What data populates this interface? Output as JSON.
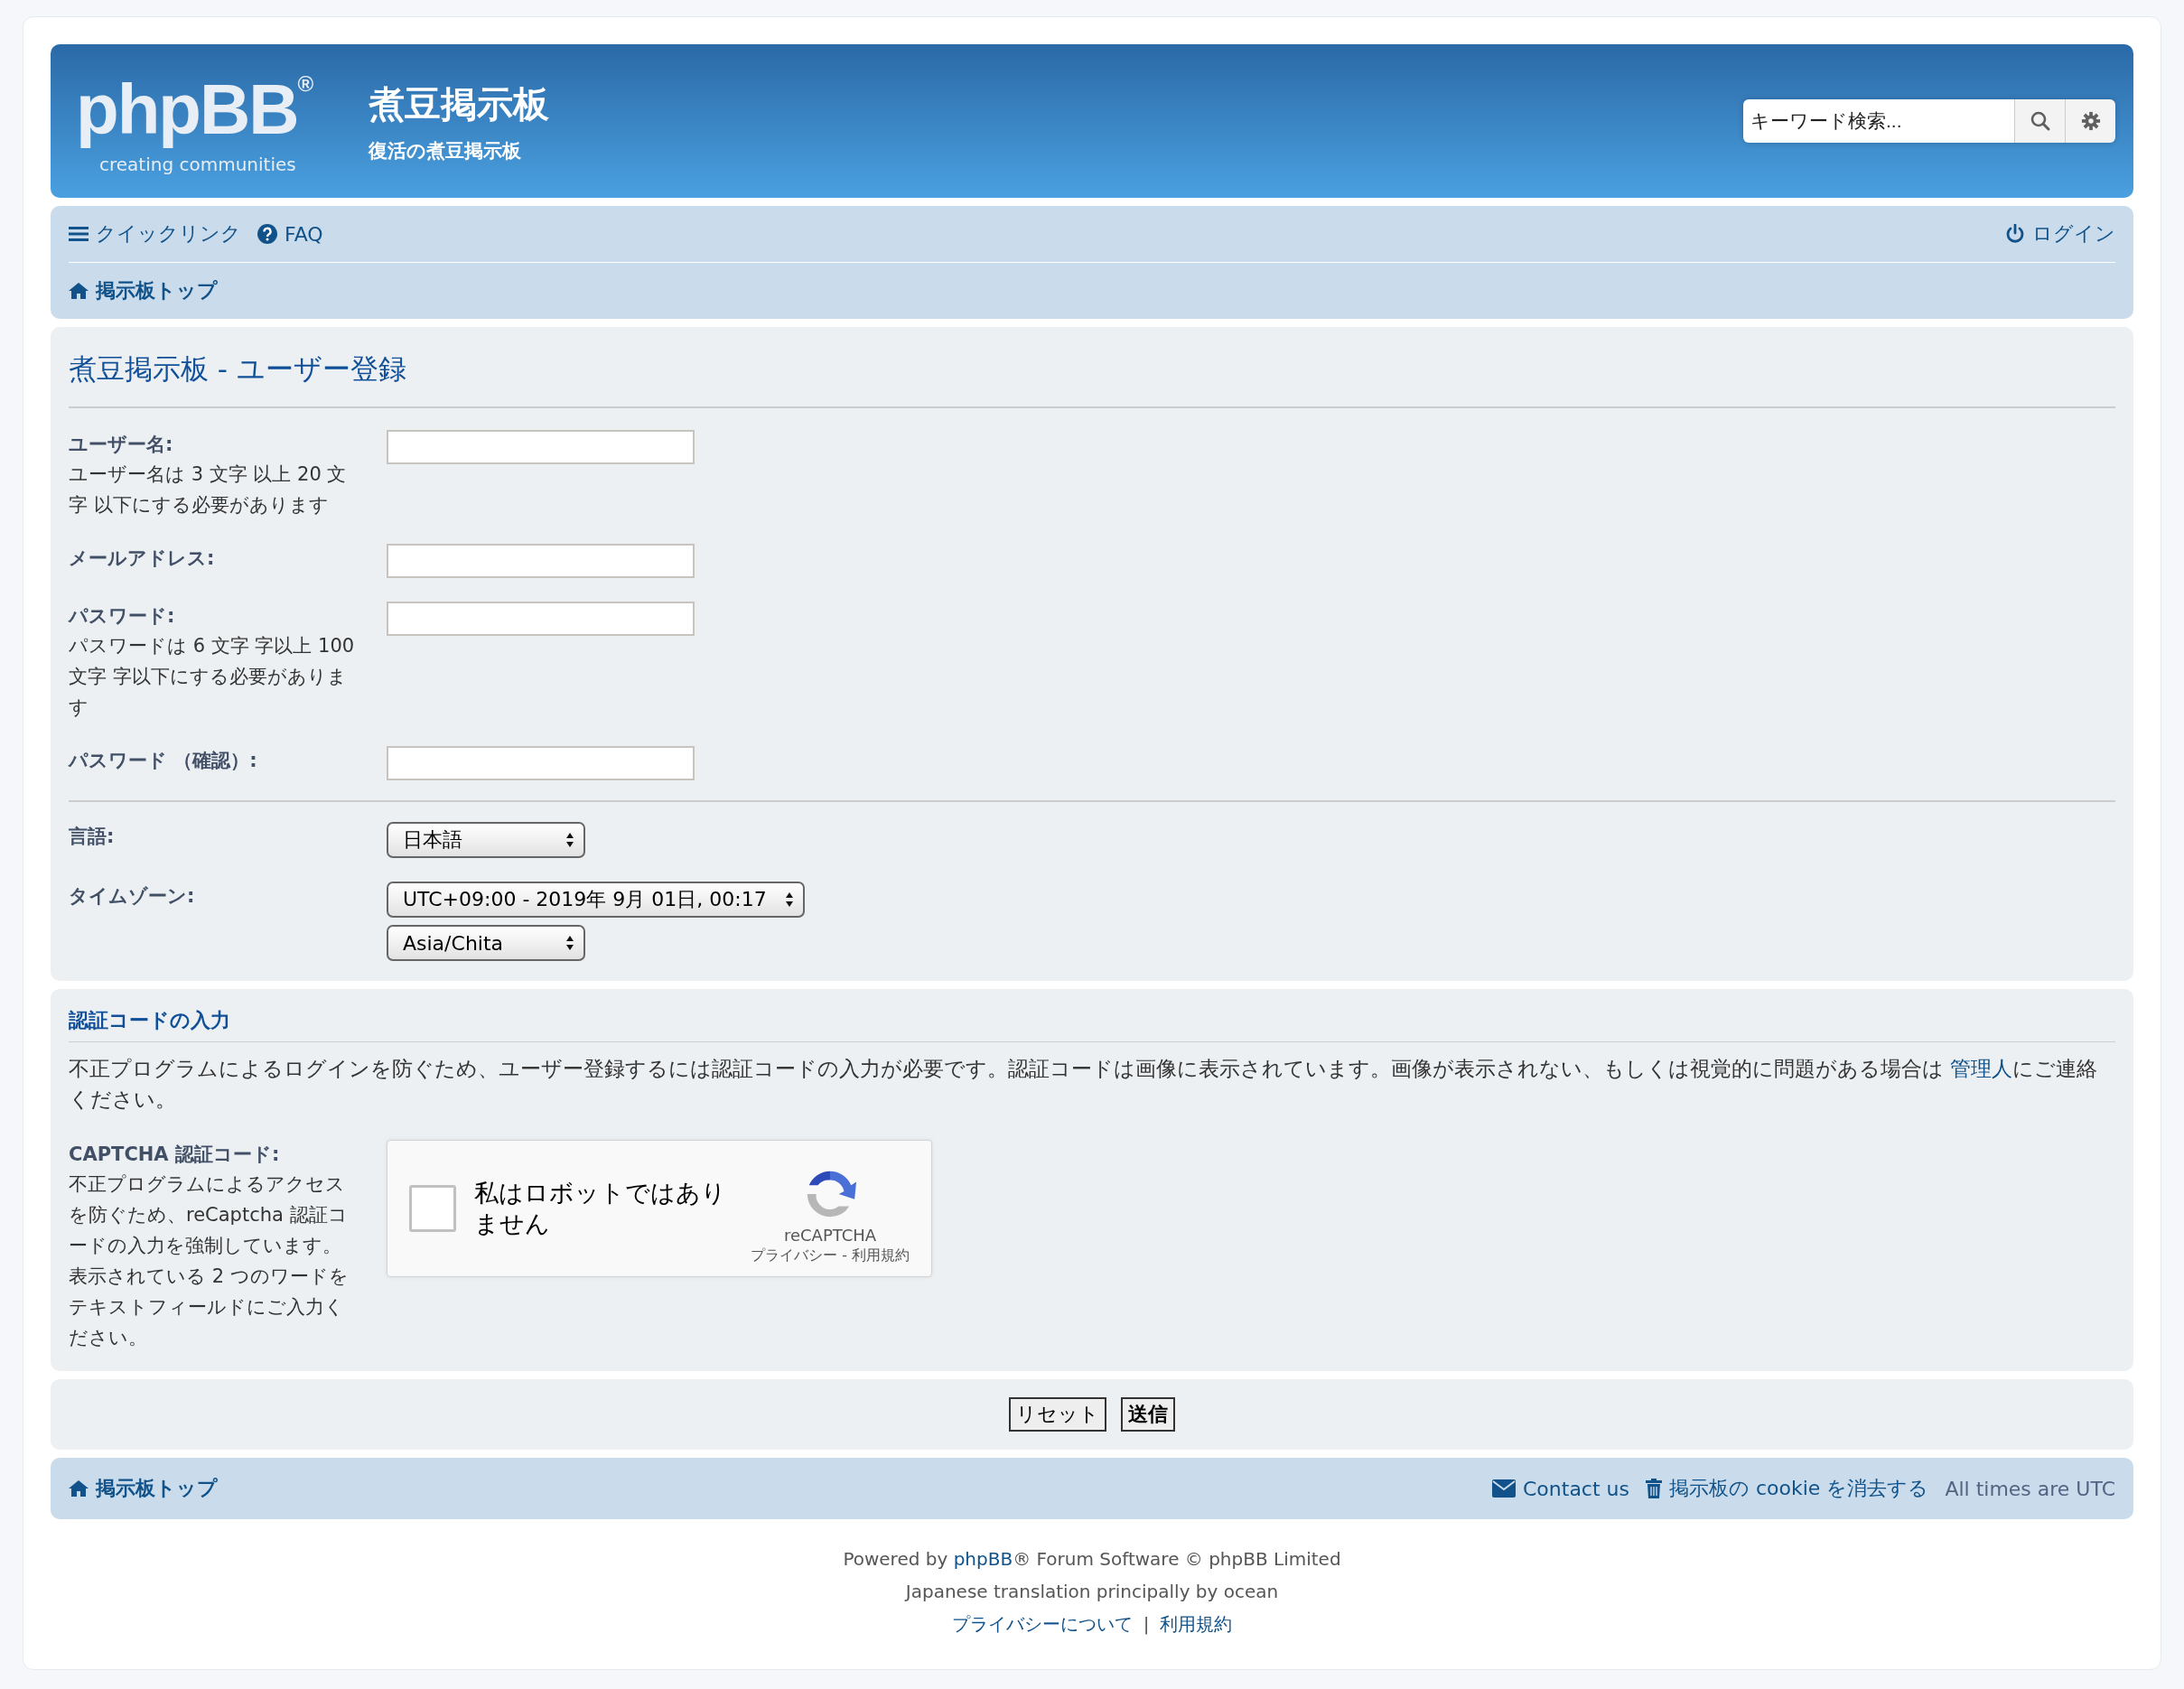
{
  "header": {
    "logo_wordmark": "phpBB$^{®}$",
    "logo_tagline": "creating communities",
    "site_title": "煮豆掲示板",
    "site_description": "復活の煮豆掲示板",
    "search": {
      "placeholder": "キーワード検索..."
    }
  },
  "navbar": {
    "links": [
      {
        "label": "クイックリンク"
      },
      {
        "label": "FAQ"
      }
    ],
    "login": "ログイン",
    "breadcrumb": "掲示板トップ"
  },
  "form": {
    "title": "煮豆掲示板 - ユーザー登録",
    "fields": [
      {
        "label": "ユーザー名:",
        "hint": "ユーザー名は 3 文字 以上 20 文字 以下にする必要があります"
      },
      {
        "label": "メールアドレス:"
      },
      {
        "label": "パスワード:",
        "hint": "パスワードは 6 文字 字以上 100 文字 字以下にする必要があります"
      },
      {
        "label": "パスワード （確認）:"
      }
    ],
    "settings": [
      {
        "label": "言語:",
        "selects": [
          "日本語"
        ]
      },
      {
        "label": "タイムゾーン:",
        "selects": [
          "UTC+09:00 - 2019年 9月 01日, 00:17",
          "Asia/Chita"
        ]
      }
    ]
  },
  "captcha": {
    "heading": "認証コードの入力",
    "intro": {
      "before": "不正プログラムによるログインを防ぐため、ユーザー登録するには認証コードの入力が必要です。認証コードは画像に表示されています。画像が表示されない、もしくは視覚的に問題がある場合は ",
      "link": "管理人",
      "after": "にご連絡ください。"
    },
    "label": "CAPTCHA 認証コード:",
    "hint": "不正プログラムによるアクセスを防ぐため、reCaptcha 認証コードの入力を強制しています。表示されている 2 つのワードをテキストフィールドにご入力ください。",
    "checkbox": {
      "label": "私はロボットではありません",
      "checked": false
    },
    "brand": "reCAPTCHA",
    "links": "プライバシー - 利用規約"
  },
  "buttons": [
    {
      "kind": "reset",
      "label": "リセット"
    },
    {
      "kind": "submit",
      "label": "送信"
    }
  ],
  "footer": {
    "home": "掲示板トップ",
    "links": [
      {
        "label": "Contact us"
      },
      {
        "label": "掲示板の cookie を消去する"
      }
    ],
    "note": "All times are UTC"
  },
  "copyright": {
    "powered": {
      "before": "Powered by ",
      "link": "phpBB",
      "after": "® Forum Software © phpBB Limited"
    },
    "translation": "Japanese translation principally by ocean",
    "links": [
      "プライバシーについて",
      "利用規約"
    ],
    "separator": "|"
  }
}
